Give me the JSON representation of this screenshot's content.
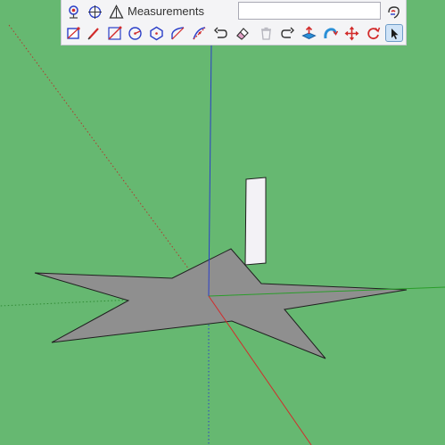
{
  "colors": {
    "background": "#66b871",
    "shape_fill": "#8f8f8f",
    "panel_fill": "#f3f2f6",
    "x_axis": "#d22b2b",
    "y_axis": "#2a9d2a",
    "z_axis": "#2a3ec8",
    "toolbar_bg": "#f4f4f6"
  },
  "toolbar": {
    "measurements_label": "Measurements",
    "measurements_value": "",
    "row1_icons": [
      "geo-location-icon",
      "orbit-target-icon",
      "measurements-icon"
    ],
    "tools": [
      {
        "id": "rectangle",
        "icon": "rectangle-icon"
      },
      {
        "id": "pencil",
        "icon": "pencil-icon"
      },
      {
        "id": "line",
        "icon": "line-icon"
      },
      {
        "id": "circle",
        "icon": "circle-icon"
      },
      {
        "id": "polygon",
        "icon": "polygon-icon"
      },
      {
        "id": "arc",
        "icon": "arc-icon"
      },
      {
        "id": "arc-2",
        "icon": "arc-pie-icon"
      },
      {
        "id": "undo",
        "icon": "undo-icon"
      },
      {
        "id": "eraser",
        "icon": "eraser-icon"
      },
      {
        "id": "delete",
        "icon": "trash-icon"
      },
      {
        "id": "redo",
        "icon": "redo-icon"
      },
      {
        "id": "push-pull",
        "icon": "push-pull-icon"
      },
      {
        "id": "follow-me",
        "icon": "follow-me-icon"
      },
      {
        "id": "move",
        "icon": "move-icon"
      },
      {
        "id": "rotate",
        "icon": "rotate-icon"
      },
      {
        "id": "select",
        "icon": "select-arrow-icon",
        "active": true
      }
    ]
  }
}
